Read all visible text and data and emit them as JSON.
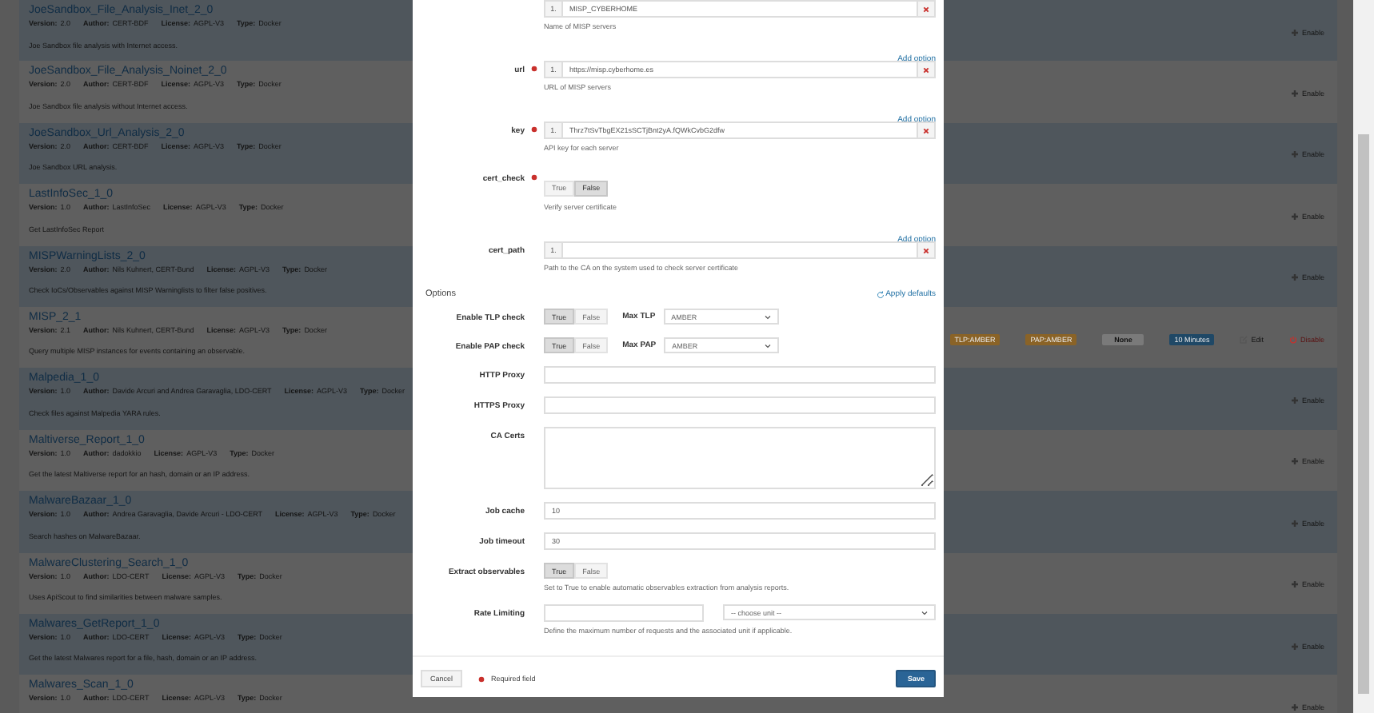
{
  "analyzers": [
    {
      "name": "JoeSandbox_File_Analysis_Inet_2_0",
      "meta": [
        [
          "Version:",
          "2.0"
        ],
        [
          "Author:",
          "CERT-BDF"
        ],
        [
          "License:",
          "AGPL-V3"
        ],
        [
          "Type:",
          "Docker"
        ]
      ],
      "description": "Joe Sandbox file analysis with Internet access.",
      "actions": [
        {
          "kind": "enable",
          "label": "Enable"
        }
      ]
    },
    {
      "name": "JoeSandbox_File_Analysis_Noinet_2_0",
      "meta": [
        [
          "Version:",
          "2.0"
        ],
        [
          "Author:",
          "CERT-BDF"
        ],
        [
          "License:",
          "AGPL-V3"
        ],
        [
          "Type:",
          "Docker"
        ]
      ],
      "description": "Joe Sandbox file analysis without Internet access.",
      "actions": [
        {
          "kind": "enable",
          "label": "Enable"
        }
      ]
    },
    {
      "name": "JoeSandbox_Url_Analysis_2_0",
      "meta": [
        [
          "Version:",
          "2.0"
        ],
        [
          "Author:",
          "CERT-BDF"
        ],
        [
          "License:",
          "AGPL-V3"
        ],
        [
          "Type:",
          "Docker"
        ]
      ],
      "description": "Joe Sandbox URL analysis.",
      "actions": [
        {
          "kind": "enable",
          "label": "Enable"
        }
      ]
    },
    {
      "name": "LastInfoSec_1_0",
      "meta": [
        [
          "Version:",
          "1.0"
        ],
        [
          "Author:",
          "LastInfoSec"
        ],
        [
          "License:",
          "AGPL-V3"
        ],
        [
          "Type:",
          "Docker"
        ]
      ],
      "description": "Get LastInfoSec Report",
      "actions": [
        {
          "kind": "enable",
          "label": "Enable"
        }
      ]
    },
    {
      "name": "MISPWarningLists_2_0",
      "meta": [
        [
          "Version:",
          "2.0"
        ],
        [
          "Author:",
          "Nils Kuhnert, CERT-Bund"
        ],
        [
          "License:",
          "AGPL-V3"
        ],
        [
          "Type:",
          "Docker"
        ]
      ],
      "description": "Check IoCs/Observables against MISP Warninglists to filter false positives.",
      "actions": [
        {
          "kind": "enable",
          "label": "Enable"
        }
      ]
    },
    {
      "name": "MISP_2_1",
      "meta": [
        [
          "Version:",
          "2.1"
        ],
        [
          "Author:",
          "Nils Kuhnert, CERT-Bund"
        ],
        [
          "License:",
          "AGPL-V3"
        ],
        [
          "Type:",
          "Docker"
        ]
      ],
      "description": "Query multiple MISP instances for events containing an observable.",
      "badges": [
        {
          "label": "TLP:AMBER",
          "color": "#8a6327"
        },
        {
          "label": "PAP:AMBER",
          "color": "#8a6327"
        },
        {
          "label": "None",
          "color": "#7a7a7a"
        },
        {
          "label": "10 Minutes",
          "color": "#1f4866"
        }
      ],
      "actions": [
        {
          "kind": "edit",
          "label": "Edit"
        },
        {
          "kind": "disable",
          "label": "Disable"
        }
      ]
    },
    {
      "name": "Malpedia_1_0",
      "meta": [
        [
          "Version:",
          "1.0"
        ],
        [
          "Author:",
          "Davide Arcuri and Andrea Garavaglia, LDO-CERT"
        ],
        [
          "License:",
          "AGPL-V3"
        ],
        [
          "Type:",
          "Docker"
        ]
      ],
      "description": "Check files against Malpedia YARA rules.",
      "actions": [
        {
          "kind": "enable",
          "label": "Enable"
        }
      ]
    },
    {
      "name": "Maltiverse_Report_1_0",
      "meta": [
        [
          "Version:",
          "1.0"
        ],
        [
          "Author:",
          "dadokkio"
        ],
        [
          "License:",
          "AGPL-V3"
        ],
        [
          "Type:",
          "Docker"
        ]
      ],
      "description": "Get the latest Maltiverse report for an hash, domain or an IP address.",
      "actions": [
        {
          "kind": "enable",
          "label": "Enable"
        }
      ]
    },
    {
      "name": "MalwareBazaar_1_0",
      "meta": [
        [
          "Version:",
          "1.0"
        ],
        [
          "Author:",
          "Andrea Garavaglia, Davide Arcuri - LDO-CERT"
        ],
        [
          "License:",
          "AGPL-V3"
        ],
        [
          "Type:",
          "Docker"
        ]
      ],
      "description": "Search hashes on MalwareBazaar.",
      "actions": [
        {
          "kind": "enable",
          "label": "Enable"
        }
      ]
    },
    {
      "name": "MalwareClustering_Search_1_0",
      "meta": [
        [
          "Version:",
          "1.0"
        ],
        [
          "Author:",
          "LDO-CERT"
        ],
        [
          "License:",
          "AGPL-V3"
        ],
        [
          "Type:",
          "Docker"
        ]
      ],
      "description": "Uses ApiScout to find similarities between malware samples.",
      "actions": [
        {
          "kind": "enable",
          "label": "Enable"
        }
      ]
    },
    {
      "name": "Malwares_GetReport_1_0",
      "meta": [
        [
          "Version:",
          "1.0"
        ],
        [
          "Author:",
          "LDO-CERT"
        ],
        [
          "License:",
          "AGPL-V3"
        ],
        [
          "Type:",
          "Docker"
        ]
      ],
      "description": "Get the latest Malwares report for a file, hash, domain or an IP address.",
      "actions": [
        {
          "kind": "enable",
          "label": "Enable"
        }
      ]
    },
    {
      "name": "Malwares_Scan_1_0",
      "meta": [
        [
          "Version:",
          "1.0"
        ],
        [
          "Author:",
          "LDO-CERT"
        ],
        [
          "License:",
          "AGPL-V3"
        ],
        [
          "Type:",
          "Docker"
        ]
      ],
      "actions": [
        {
          "kind": "enable",
          "label": "Enable"
        }
      ]
    }
  ],
  "modal": {
    "fields": [
      {
        "kind": "list",
        "items": [
          {
            "index": "1.",
            "value": "MISP_CYBERHOME"
          }
        ],
        "help": "Name of MISP servers"
      },
      {
        "kind": "list",
        "label": "url",
        "required": true,
        "add_option": "Add option",
        "items": [
          {
            "index": "1.",
            "value": "https://misp.cyberhome.es"
          }
        ],
        "help": "URL of MISP servers"
      },
      {
        "kind": "list",
        "label": "key",
        "required": true,
        "add_option": "Add option",
        "items": [
          {
            "index": "1.",
            "value": "Thrz7tSvTbgEX21sSCTjBnt2yA.fQWkCvbG2dfw"
          }
        ],
        "help": "API key for each server"
      },
      {
        "kind": "toggle",
        "label": "cert_check",
        "required": true,
        "options": [
          {
            "label": "True",
            "selected": false
          },
          {
            "label": "False",
            "selected": true
          }
        ],
        "help": "Verify server certificate"
      },
      {
        "kind": "list",
        "label": "cert_path",
        "add_option": "Add option",
        "items": [
          {
            "index": "1.",
            "value": ""
          }
        ],
        "help": "Path to the CA on the system used to check server certificate"
      }
    ],
    "options_title": "Options",
    "apply_defaults": "Apply defaults",
    "options": [
      {
        "kind": "toggle",
        "label": "Enable TLP check",
        "options": [
          {
            "label": "True",
            "selected": true
          },
          {
            "label": "False",
            "selected": false
          }
        ],
        "select": {
          "label": "Max TLP",
          "value": "AMBER"
        }
      },
      {
        "kind": "toggle",
        "label": "Enable PAP check",
        "options": [
          {
            "label": "True",
            "selected": true
          },
          {
            "label": "False",
            "selected": false
          }
        ],
        "select": {
          "label": "Max PAP",
          "value": "AMBER"
        }
      },
      {
        "kind": "text",
        "label": "HTTP Proxy"
      },
      {
        "kind": "text",
        "label": "HTTPS Proxy"
      },
      {
        "kind": "textarea",
        "label": "CA Certs"
      },
      {
        "kind": "text",
        "label": "Job cache",
        "value": "10"
      },
      {
        "kind": "text",
        "label": "Job timeout",
        "value": "30"
      },
      {
        "kind": "toggle",
        "label": "Extract observables",
        "options": [
          {
            "label": "True",
            "selected": true
          },
          {
            "label": "False",
            "selected": false
          }
        ],
        "help": "Set to True to enable automatic observables extraction from analysis reports."
      },
      {
        "kind": "rate",
        "label": "Rate Limiting",
        "unit_placeholder": "-- choose unit --",
        "help": "Define the maximum number of requests and the associated unit if applicable."
      }
    ],
    "cancel": "Cancel",
    "required_note": "Required field",
    "save": "Save"
  }
}
